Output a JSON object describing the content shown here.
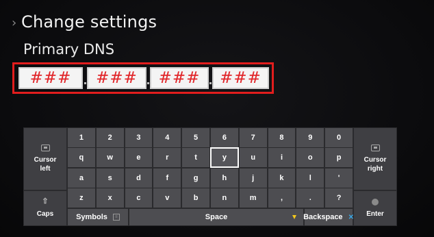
{
  "header": {
    "back_glyph": "›",
    "title": "Change settings",
    "subtitle": "Primary DNS"
  },
  "dns": {
    "octets": [
      "###",
      "###",
      "###",
      "###"
    ],
    "highlight_color": "#e21d1d"
  },
  "keyboard": {
    "selected_key": "y",
    "row_numbers": [
      "1",
      "2",
      "3",
      "4",
      "5",
      "6",
      "7",
      "8",
      "9",
      "0"
    ],
    "row_top": [
      "q",
      "w",
      "e",
      "r",
      "t",
      "y",
      "u",
      "i",
      "o",
      "p"
    ],
    "row_home": [
      "a",
      "s",
      "d",
      "f",
      "g",
      "h",
      "j",
      "k",
      "l",
      "'"
    ],
    "row_bottom": [
      "z",
      "x",
      "c",
      "v",
      "b",
      "n",
      "m",
      ",",
      ".",
      "?"
    ],
    "cursor_left": "Cursor left",
    "cursor_right": "Cursor right",
    "caps": "Caps",
    "symbols": "Symbols",
    "space": "Space",
    "backspace": "Backspace",
    "enter": "Enter"
  }
}
